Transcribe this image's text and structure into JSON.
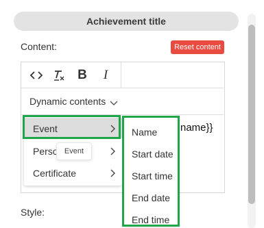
{
  "header": {
    "title": "Achievement title"
  },
  "content": {
    "label": "Content:",
    "reset_label": "Reset content"
  },
  "toolbar": {
    "icons": [
      "code-icon",
      "clear-format-icon",
      "bold-icon",
      "italic-icon"
    ],
    "bold_glyph": "B",
    "italic_glyph": "I"
  },
  "dynamic": {
    "label": "Dynamic contents"
  },
  "editor": {
    "visible_text": "name}}"
  },
  "menu": {
    "items": [
      {
        "label": "Event"
      },
      {
        "label": "Perso"
      },
      {
        "label": "Certificate"
      }
    ]
  },
  "tooltip": {
    "text": "Event"
  },
  "submenu": {
    "items": [
      {
        "label": "Name"
      },
      {
        "label": "Start date"
      },
      {
        "label": "Start time"
      },
      {
        "label": "End date"
      },
      {
        "label": "End time"
      }
    ]
  },
  "style": {
    "label": "Style:"
  },
  "colors": {
    "highlight": "#1fa54a",
    "reset_button": "#ea4b41",
    "title_bar": "#e3e3e3",
    "active_item": "#dcdcdc"
  }
}
